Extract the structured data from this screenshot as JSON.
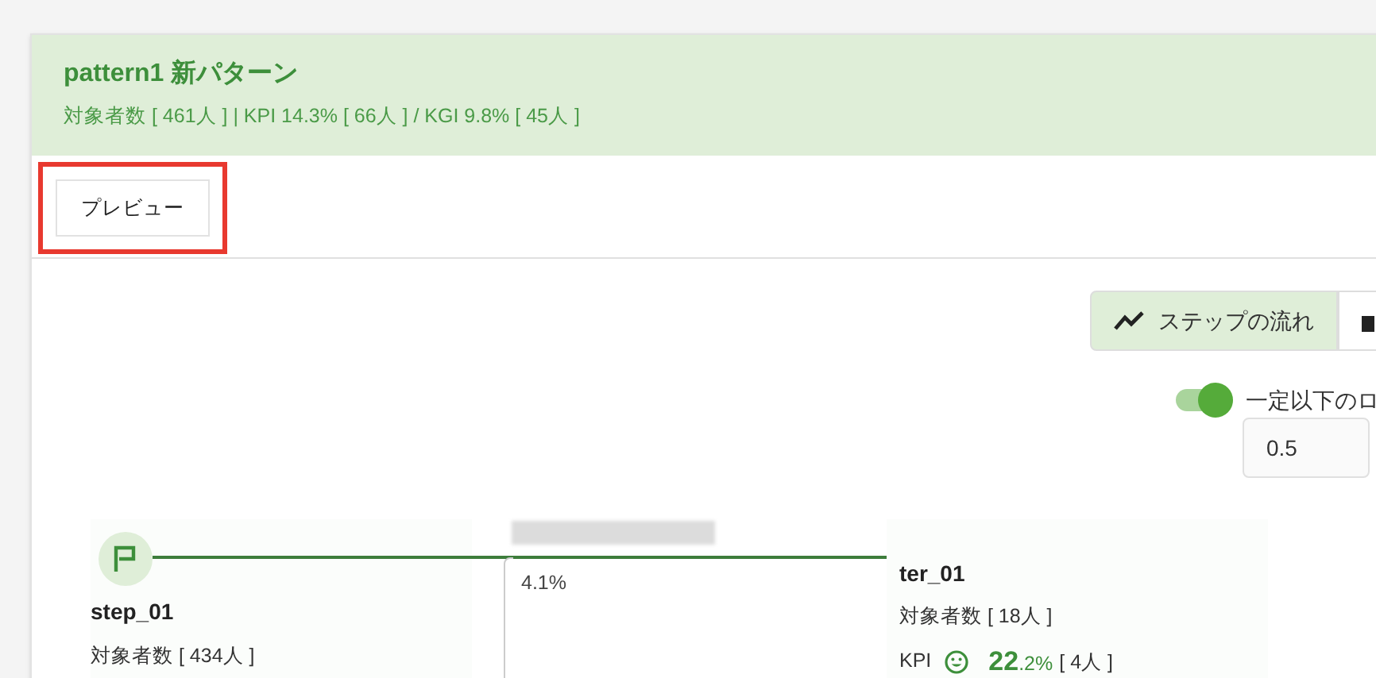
{
  "header": {
    "title": "pattern1 新パターン",
    "summary": "対象者数 [ 461人 ] | KPI 14.3% [ 66人 ] / KGI 9.8% [ 45人 ]"
  },
  "toolbar": {
    "preview_button": "プレビュー",
    "highlighted": true
  },
  "view_tabs": [
    {
      "kind": "line",
      "label": "ステップの流れ",
      "selected": true
    },
    {
      "kind": "bar",
      "selected": false
    }
  ],
  "threshold": {
    "on": true,
    "label": "一定以下のロ",
    "value": "0.5"
  },
  "flow": {
    "start": {
      "name": "step_01",
      "count": "対象者数 [ 434人 ]"
    },
    "edge": {
      "rate": "4.1%"
    },
    "target": {
      "name": "ter_01",
      "count": "対象者数 [ 18人 ]",
      "kpi_label": "KPI",
      "kpi_int": "22",
      "kpi_dec": ".2%",
      "kpi_count": "[ 4人 ]"
    }
  }
}
